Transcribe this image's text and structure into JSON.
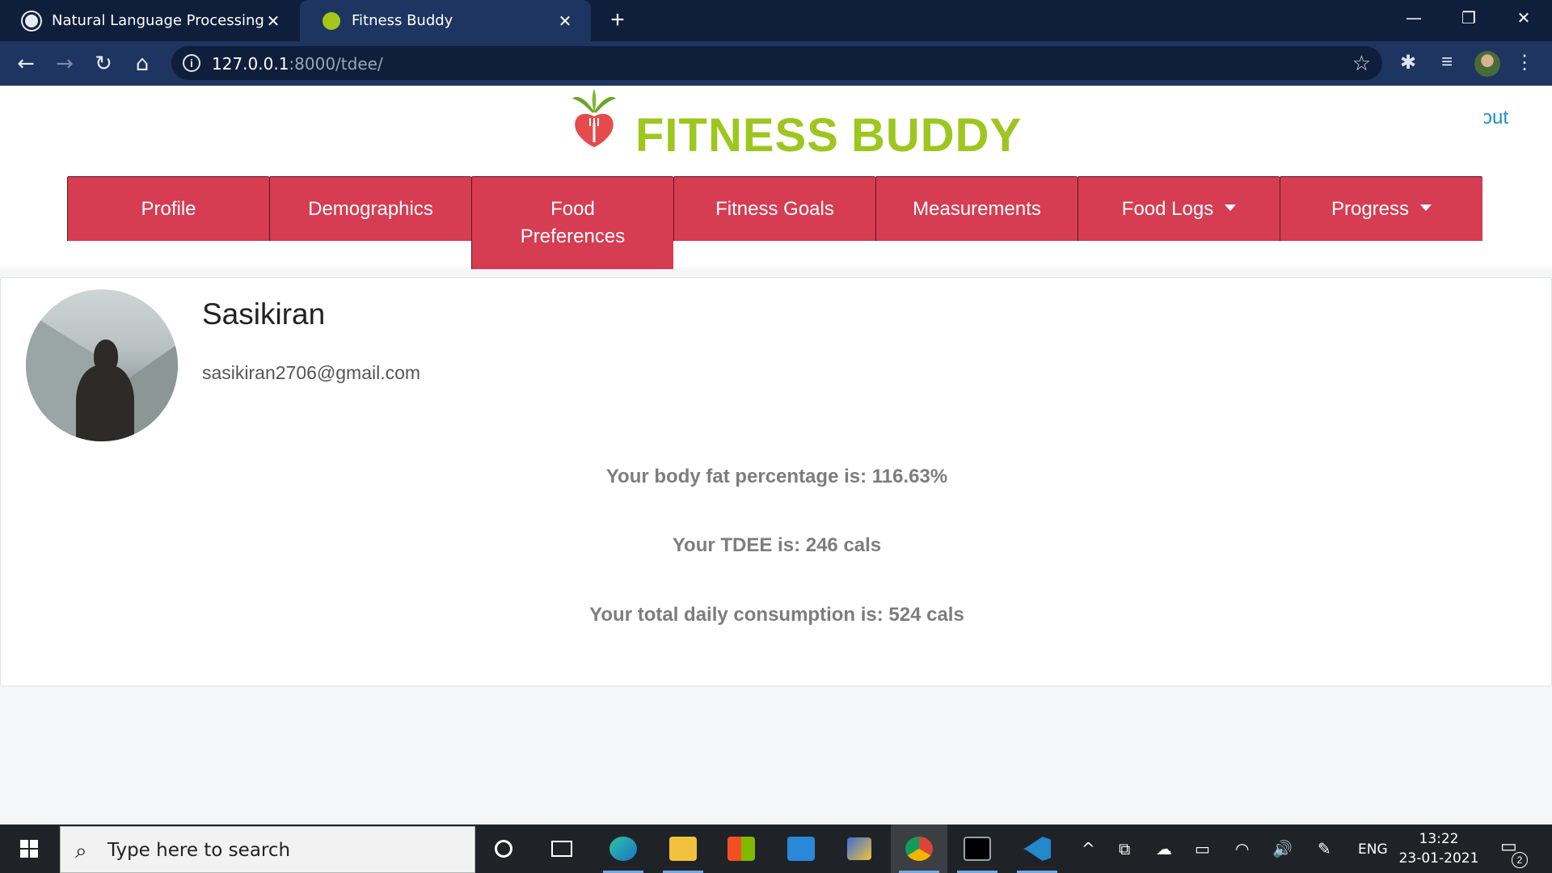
{
  "browser": {
    "tabs": [
      {
        "title": "Natural Language Processing",
        "icon": "globe-icon",
        "active": false
      },
      {
        "title": "Fitness Buddy",
        "icon": "fitness-buddy-favicon",
        "active": true
      }
    ],
    "new_tab": "+",
    "window_controls": {
      "minimize": "—",
      "restore": "❐",
      "close": "✕"
    },
    "nav": {
      "back": "←",
      "forward": "→",
      "reload": "↻",
      "home": "⌂"
    },
    "url": {
      "host": "127.0.0.1",
      "path": ":8000/tdee/"
    },
    "star": "☆",
    "extensions": {
      "puzzle": "✱",
      "media": "≡"
    }
  },
  "header": {
    "brand_word_1": "FITNESS",
    "brand_word_2": "BUDDY",
    "brand_color": "#9dc71f",
    "logout_label": "Logout",
    "nav_color": "#d63c52",
    "nav": [
      {
        "label": "Profile",
        "dropdown": false
      },
      {
        "label": "Demographics",
        "dropdown": false
      },
      {
        "label": "Food Preferences",
        "dropdown": false
      },
      {
        "label": "Fitness Goals",
        "dropdown": false
      },
      {
        "label": "Measurements",
        "dropdown": false
      },
      {
        "label": "Food Logs",
        "dropdown": true
      },
      {
        "label": "Progress",
        "dropdown": true
      }
    ]
  },
  "profile": {
    "name": "Sasikiran",
    "email": "sasikiran2706@gmail.com",
    "stats": [
      "Your body fat percentage is: 116.63%",
      "Your TDEE is: 246 cals",
      "Your total daily consumption is: 524 cals"
    ]
  },
  "taskbar": {
    "search_placeholder": "Type here to search",
    "search_icon": "⌕",
    "tray_icons": [
      "^",
      "⧉",
      "☁",
      "▭",
      "◠",
      "🔊",
      "✎"
    ],
    "language": "ENG",
    "time": "13:22",
    "date": "23-01-2021",
    "notification_count": "2"
  }
}
